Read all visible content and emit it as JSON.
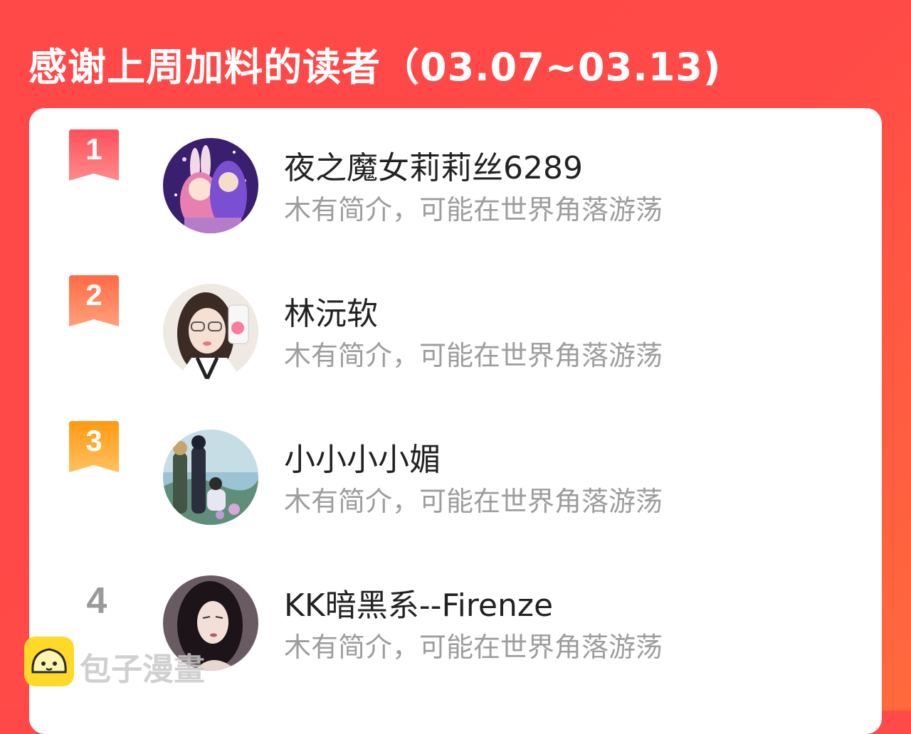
{
  "title": "感谢上周加料的读者（03.07~03.13)",
  "readers": [
    {
      "rank": "1",
      "name": "夜之魔女莉莉丝6289",
      "bio": "木有简介，可能在世界角落游荡"
    },
    {
      "rank": "2",
      "name": "林沅软",
      "bio": "木有简介，可能在世界角落游荡"
    },
    {
      "rank": "3",
      "name": "小小小小媚",
      "bio": "木有简介，可能在世界角落游荡"
    },
    {
      "rank": "4",
      "name": "KK暗黑系--Firenze",
      "bio": "木有简介，可能在世界角落游荡"
    }
  ],
  "watermark": {
    "text": "包子漫畫",
    "icon": "bun-face-icon"
  },
  "colors": {
    "header": "#ff4848",
    "rank1": "#ff5a5f",
    "rank2": "#ff7a50",
    "rank3": "#ffa020",
    "rank_plain": "#9a9a9a"
  }
}
